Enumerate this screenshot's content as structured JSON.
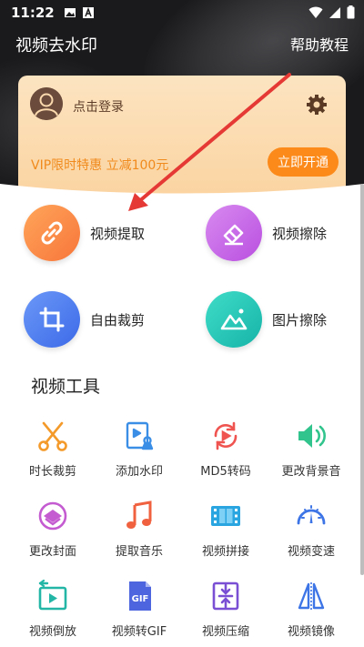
{
  "status_bar": {
    "time": "11:22"
  },
  "header": {
    "title": "视频去水印",
    "help": "帮助教程"
  },
  "member_card": {
    "login": "点击登录",
    "vip_promo": "VIP限时特惠 立减100元",
    "open_button": "立即开通"
  },
  "features": [
    {
      "label": "视频提取",
      "icon": "link-icon",
      "color": "#fb8a4a"
    },
    {
      "label": "视频擦除",
      "icon": "eraser-icon",
      "color": "#c661e6"
    },
    {
      "label": "自由裁剪",
      "icon": "crop-icon",
      "color": "#4f7ef2"
    },
    {
      "label": "图片擦除",
      "icon": "image-icon",
      "color": "#25c9b9"
    }
  ],
  "tools_section": {
    "title": "视频工具"
  },
  "tools": [
    {
      "label": "时长裁剪",
      "icon": "scissors-icon"
    },
    {
      "label": "添加水印",
      "icon": "add-watermark-icon"
    },
    {
      "label": "MD5转码",
      "icon": "md5-convert-icon"
    },
    {
      "label": "更改背景音",
      "icon": "speaker-icon"
    },
    {
      "label": "更改封面",
      "icon": "cover-icon"
    },
    {
      "label": "提取音乐",
      "icon": "music-note-icon"
    },
    {
      "label": "视频拼接",
      "icon": "film-strip-icon"
    },
    {
      "label": "视频变速",
      "icon": "speedometer-icon"
    },
    {
      "label": "视频倒放",
      "icon": "reverse-play-icon"
    },
    {
      "label": "视频转GIF",
      "icon": "gif-icon"
    },
    {
      "label": "视频压缩",
      "icon": "compress-icon"
    },
    {
      "label": "视频镜像",
      "icon": "mirror-icon"
    }
  ]
}
